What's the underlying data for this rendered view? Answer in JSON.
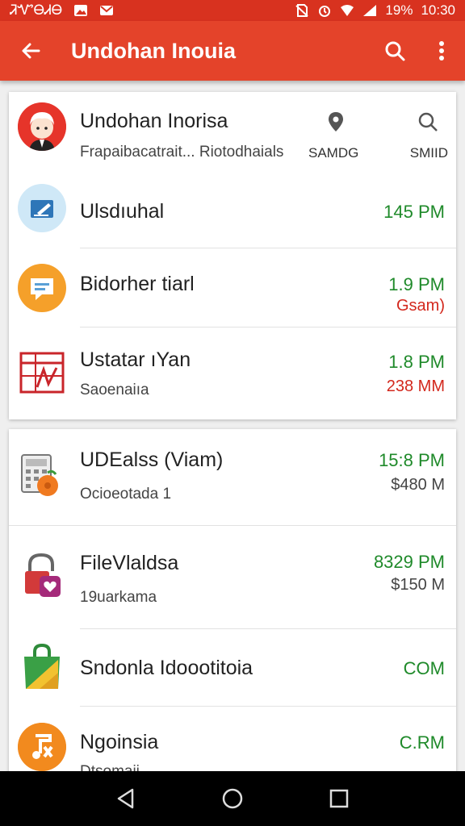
{
  "status_bar": {
    "carrier": "ᏘᏉᎾᏗᎾ",
    "battery": "19%",
    "time": "10:30"
  },
  "app_bar": {
    "title": "Undohan Inouia",
    "icons": [
      "arrow-back-icon",
      "search-icon",
      "more-vert-icon"
    ]
  },
  "card_1": {
    "profile": {
      "name": "Undohan Inorisa",
      "subtitle": "Frapaibacatrait... Riotodhaials",
      "location_label": "SAMDG",
      "search_label": "SMIID"
    },
    "items": [
      {
        "name": "Ulsdıuhal",
        "time": "145 PM",
        "icon": "edit-card-icon"
      },
      {
        "name": "Bidorher tiarl",
        "time": "1.9 PM",
        "amount": "Gsam)",
        "icon": "message-icon"
      },
      {
        "name": "Ustatar ıYan",
        "subtitle": "Saoenaiıa",
        "time": "1.8 PM",
        "amount": "238 MM",
        "icon": "calendar-chart-icon"
      }
    ]
  },
  "card_2": {
    "items": [
      {
        "name": "UDEalss (Viam)",
        "subtitle": "Ocioeotada 1",
        "time": "15:8 PM",
        "amount": "$480 M",
        "icon": "calculator-icon"
      },
      {
        "name": "FileVlaldsa",
        "subtitle": "19uarkama",
        "time": "8329 PM",
        "amount": "$150 M",
        "icon": "lock-heart-icon"
      },
      {
        "name": "Sndonla Idoootitoia",
        "time": "COM",
        "icon": "shopping-bag-icon"
      },
      {
        "name": "Ngoinsia",
        "subtitle": "Dtsomaii",
        "time": "C.RM",
        "icon": "music-note-icon"
      }
    ]
  },
  "nav_bar": {
    "icons": [
      "nav-back-icon",
      "nav-home-icon",
      "nav-recents-icon"
    ]
  },
  "colors": {
    "app_bar": "#e4432a",
    "status_bar": "#d8321f",
    "time_green": "#1f8a2a",
    "amount_red": "#d3281d"
  }
}
